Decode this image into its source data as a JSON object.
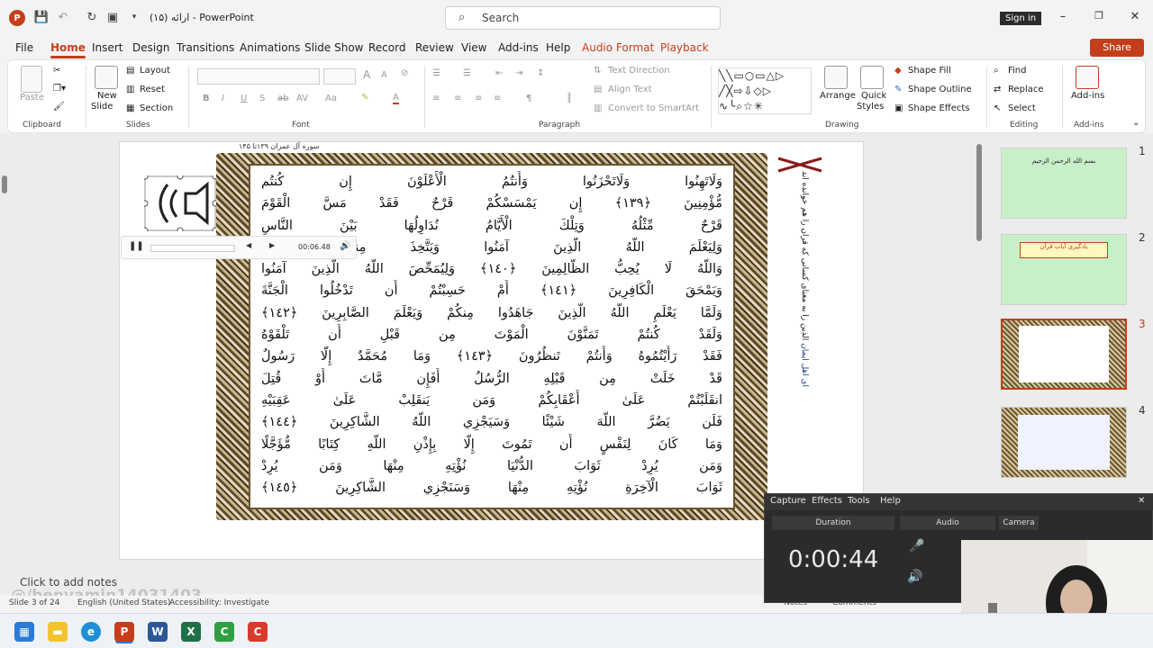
{
  "title": {
    "doc_title": "ارائه (۱۵) - PowerPoint",
    "sign_in": "Sign in",
    "search_label": "Search",
    "app_letter": "P"
  },
  "menu": [
    "File",
    "Home",
    "Insert",
    "Design",
    "Transitions",
    "Animations",
    "Slide Show",
    "Record",
    "Review",
    "View",
    "Add-ins",
    "Help",
    "Audio Format",
    "Playback"
  ],
  "share": "Share",
  "ribbon": {
    "clipboard": {
      "label": "Clipboard",
      "paste": "Paste"
    },
    "slides": {
      "label": "Slides",
      "new_slide": "New",
      "new_slide2": "Slide",
      "layout": "Layout",
      "reset": "Reset",
      "section": "Section"
    },
    "font": {
      "label": "Font",
      "bold": "B",
      "italic": "I",
      "underline": "U",
      "strike": "S",
      "shadow": "ab",
      "grow": "A",
      "shrink": "A",
      "aa": "Aa",
      "font_color": "A"
    },
    "paragraph": {
      "label": "Paragraph",
      "text_direction": "Text Direction",
      "align_text": "Align Text",
      "smartart": "Convert to SmartArt"
    },
    "drawing": {
      "label": "Drawing",
      "arrange": "Arrange",
      "quick": "Quick",
      "styles": "Styles",
      "shape_fill": "Shape Fill",
      "shape_outline": "Shape Outline",
      "shape_effects": "Shape Effects"
    },
    "editing": {
      "label": "Editing",
      "find": "Find",
      "replace": "Replace",
      "select": "Select"
    },
    "addins": {
      "label": "Add-ins",
      "addins_btn": "Add-ins"
    }
  },
  "slide": {
    "header": "سوره آل عمران ۱۳۹تا ۱۴۵",
    "verses": [
      "وَلَاتَهِنُوا وَلَاتَحْزَنُوا وَأَنتُمُ الْأَعْلَوْنَ إِن كُنتُم",
      "مُّؤْمِنِينَ ﴿١٣٩﴾ إِن يَمْسَسْكُمْ قَرْحٌ فَقَدْ مَسَّ الْقَوْمَ",
      "قَرْحٌ مِّثْلُهُ وَتِلْكَ الْأَيَّامُ نُدَاوِلُهَا بَيْنَ النَّاسِ",
      "وَلِيَعْلَمَ اللَّهُ الَّذِينَ آمَنُوا وَيَتَّخِذَ مِنكُمْ شُهَدَاءَ",
      "وَاللَّهُ لَا يُحِبُّ الظَّالِمِينَ ﴿١٤٠﴾ وَلِيُمَحِّصَ اللَّهُ الَّذِينَ آمَنُوا",
      "وَيَمْحَقَ الْكَافِرِينَ ﴿١٤١﴾ أَمْ حَسِبْتُمْ أَن تَدْخُلُوا الْجَنَّةَ",
      "وَلَمَّا يَعْلَمِ اللَّهُ الَّذِينَ جَاهَدُوا مِنكُمْ وَيَعْلَمَ الصَّابِرِينَ ﴿١٤٢﴾",
      "وَلَقَدْ كُنتُمْ تَمَنَّوْنَ الْمَوْتَ مِن قَبْلِ أَن تَلْقَوْهُ",
      "فَقَدْ رَأَيْتُمُوهُ وَأَنتُمْ تَنظُرُونَ ﴿١٤٣﴾ وَمَا مُحَمَّدٌ إِلَّا رَسُولٌ",
      "قَدْ خَلَتْ مِن قَبْلِهِ الرُّسُلُ أَفَإِن مَّاتَ أَوْ قُتِلَ",
      "انقَلَبْتُمْ عَلَىٰ أَعْقَابِكُمْ وَمَن يَنقَلِبْ عَلَىٰ عَقِبَيْهِ",
      "فَلَن يَضُرَّ اللَّهَ شَيْئًا وَسَيَجْزِي اللَّهُ الشَّاكِرِينَ ﴿١٤٤﴾",
      "وَمَا كَانَ لِنَفْسٍ أَن تَمُوتَ إِلَّا بِإِذْنِ اللَّهِ كِتَابًا مُّؤَجَّلًا",
      "وَمَن يُرِدْ ثَوَابَ الدُّنْيَا نُؤْتِهِ مِنْهَا وَمَن يُرِدْ",
      "ثَوَابَ الْآخِرَةِ نُؤْتِهِ مِنْهَا وَسَنَجْزِي الشَّاكِرِينَ ﴿١٤٥﴾"
    ],
    "side_note_blue": "ای اهل ایمان",
    "side_note": "الذین را به معنای کسانی که قرآن را هم خوانده اند",
    "audio_time": "00:06.48"
  },
  "notes_placeholder": "Click to add notes",
  "watermark": "@/benyamin14031403",
  "status": {
    "slide_of": "Slide 3 of 24",
    "language": "English (United States)",
    "accessibility": "Accessibility: Investigate",
    "notes": "Notes",
    "comments": "Comments"
  },
  "thumbnails": {
    "numbers": [
      "1",
      "2",
      "3",
      "4"
    ],
    "t1_line": "بسم الله الرحمن الرحيم",
    "t2_line": "یادگیری آیات قرآن"
  },
  "recorder": {
    "menu": [
      "Capture",
      "Effects",
      "Tools",
      "Help"
    ],
    "duration_label": "Duration",
    "audio_label": "Audio",
    "camera_label": "Camera",
    "time": "0:00:44"
  },
  "colors": {
    "accent": "#c43e1c",
    "green_thumb": "#c8f0c8"
  }
}
